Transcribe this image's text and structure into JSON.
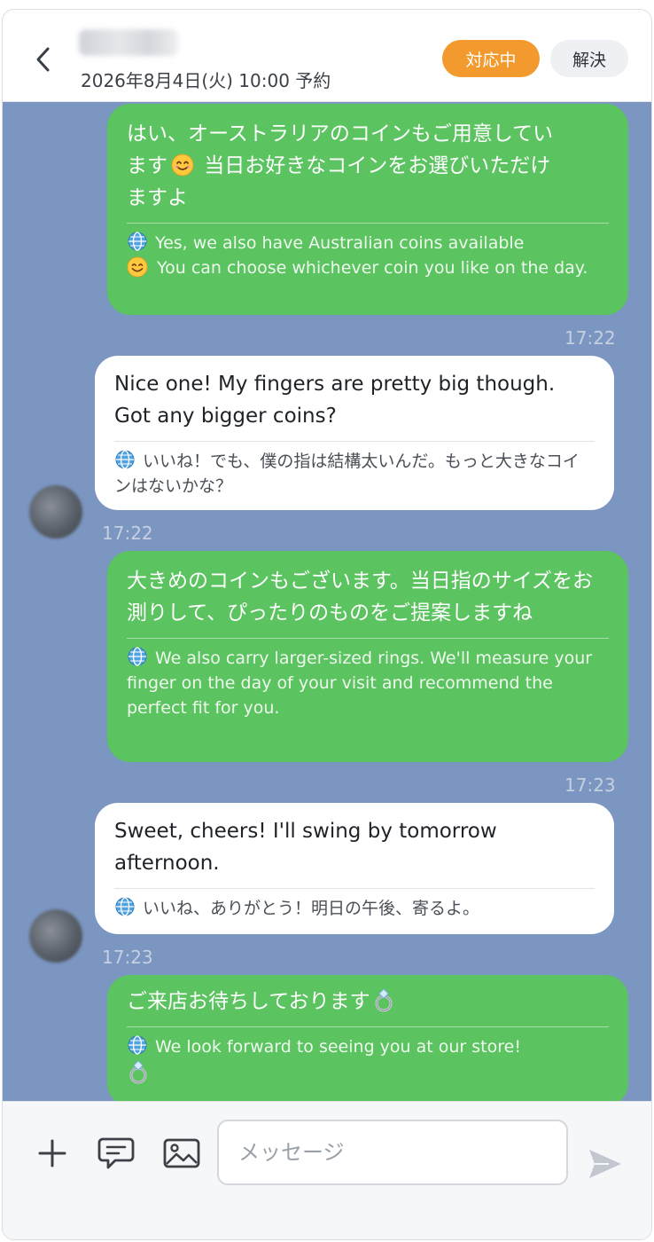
{
  "header": {
    "reservation": "2026年8月4日(火) 10:00 予約",
    "status_label": "対応中",
    "resolve_label": "解決"
  },
  "messages": [
    {
      "direction": "out",
      "text_a": "はい、オーストラリアのコインもご用意してい",
      "text_b": "ます",
      "text_c": " 当日お好きなコインをお選びいただけ",
      "text_d": "ますよ",
      "trans_a": "Yes, we also have Australian coins available",
      "trans_b": " You can choose whichever coin you like on the day.",
      "time": "17:22"
    },
    {
      "direction": "in",
      "text": "Nice one! My fingers are pretty big though. Got any bigger coins?",
      "trans": "いいね！でも、僕の指は結構太いんだ。もっと大きなコインはないかな？",
      "time": "17:22"
    },
    {
      "direction": "out",
      "text": "大きめのコインもございます。当日指のサイズをお測りして、ぴったりのものをご提案しますね",
      "trans": "We also carry larger-sized rings. We'll measure your finger on the day of your visit and recommend the perfect fit for you.",
      "time": "17:23"
    },
    {
      "direction": "in",
      "text": "Sweet, cheers! I'll swing by tomorrow afternoon.",
      "trans": "いいね、ありがとう！明日の午後、寄るよ。",
      "time": "17:23"
    },
    {
      "direction": "out",
      "text": "ご来店お待ちしております",
      "trans": "We look forward to seeing you at our store!"
    }
  ],
  "input": {
    "placeholder": "メッセージ"
  },
  "icons": {
    "back": "chevron-left-icon",
    "add": "plus-icon",
    "template": "chat-bubble-icon",
    "image": "image-icon",
    "send": "send-icon"
  },
  "colors": {
    "outgoing_bubble": "#5bc35f",
    "chat_background": "#7b96c1",
    "status_badge": "#f29a2e"
  }
}
